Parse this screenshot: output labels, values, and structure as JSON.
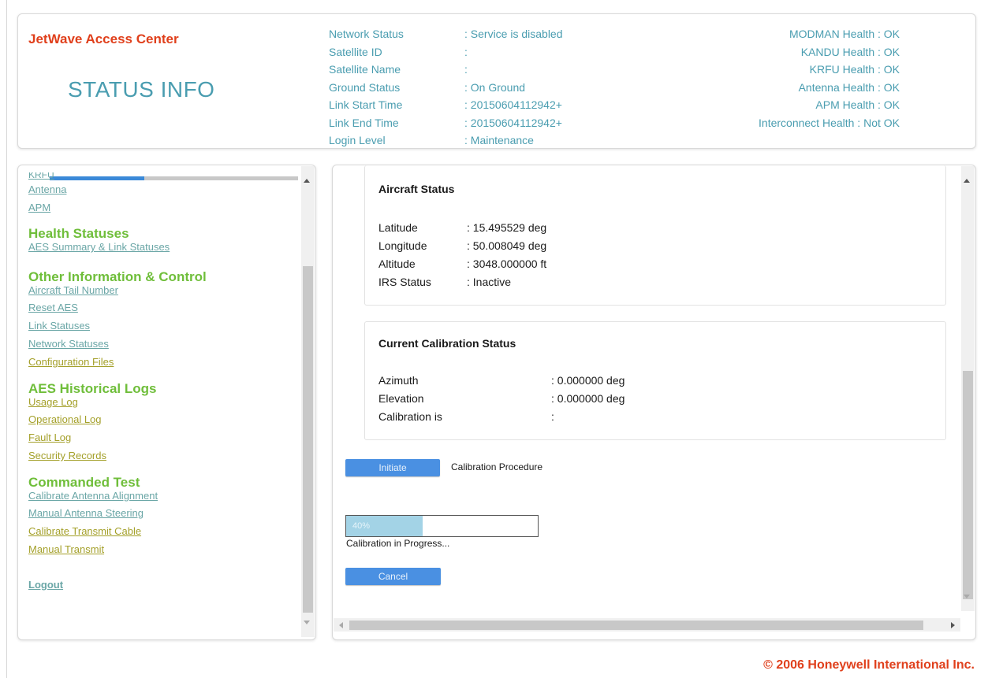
{
  "header": {
    "brand": "JetWave Access Center",
    "page_title": "STATUS INFO",
    "info": [
      {
        "label": "Network Status",
        "value": ": Service is disabled"
      },
      {
        "label": "Satellite ID",
        "value": ":"
      },
      {
        "label": "Satellite Name",
        "value": ":"
      },
      {
        "label": "Ground Status",
        "value": ": On Ground"
      },
      {
        "label": "Link Start Time",
        "value": ": 20150604112942+"
      },
      {
        "label": "Link End Time",
        "value": ": 20150604112942+"
      },
      {
        "label": "Login Level",
        "value": ": Maintenance"
      }
    ],
    "health": [
      "MODMAN Health : OK",
      "KANDU Health : OK",
      "KRFU Health : OK",
      "Antenna Health : OK",
      "APM Health : OK",
      "Interconnect Health : Not OK"
    ]
  },
  "sidebar": {
    "clipped_item": "KRFU",
    "top_items": [
      "Antenna",
      "APM"
    ],
    "sections": [
      {
        "title": "Health Statuses",
        "items": [
          "AES Summary & Link Statuses"
        ]
      },
      {
        "title": "Other Information & Control",
        "items": [
          "Aircraft Tail Number",
          "Reset AES",
          "Link Statuses",
          "Network Statuses",
          "Configuration Files"
        ]
      },
      {
        "title": "AES Historical Logs",
        "items": [
          "Usage Log",
          "Operational Log",
          "Fault Log",
          "Security Records"
        ]
      },
      {
        "title": "Commanded Test",
        "items": [
          "Calibrate Antenna Alignment",
          "Manual Antenna Steering",
          "Calibrate Transmit Cable",
          "Manual Transmit"
        ]
      }
    ],
    "logout": "Logout"
  },
  "aircraft_status": {
    "title": "Aircraft Status",
    "rows": [
      {
        "label": "Latitude",
        "value": ": 15.495529 deg"
      },
      {
        "label": "Longitude",
        "value": ": 50.008049 deg"
      },
      {
        "label": "Altitude",
        "value": ": 3048.000000 ft"
      },
      {
        "label": "IRS Status",
        "value": ": Inactive"
      }
    ]
  },
  "calibration_status": {
    "title": "Current Calibration Status",
    "rows": [
      {
        "label": "Azimuth",
        "value": ": 0.000000 deg"
      },
      {
        "label": "Elevation",
        "value": ": 0.000000 deg"
      },
      {
        "label": "Calibration is",
        "value": ":"
      }
    ]
  },
  "actions": {
    "initiate_label": "Initiate",
    "procedure_label": "Calibration Procedure",
    "progress_text": "40%",
    "progress_value": 0.4,
    "progress_caption": "Calibration in Progress...",
    "cancel_label": "Cancel"
  },
  "footer": {
    "copyright": "© 2006 Honeywell International Inc."
  },
  "colors": {
    "brand": "#e0401c",
    "info_text": "#4a9db0",
    "section_title": "#6fbe3a",
    "button": "#4a90e2",
    "progress_fill": "#a3d3e6"
  }
}
